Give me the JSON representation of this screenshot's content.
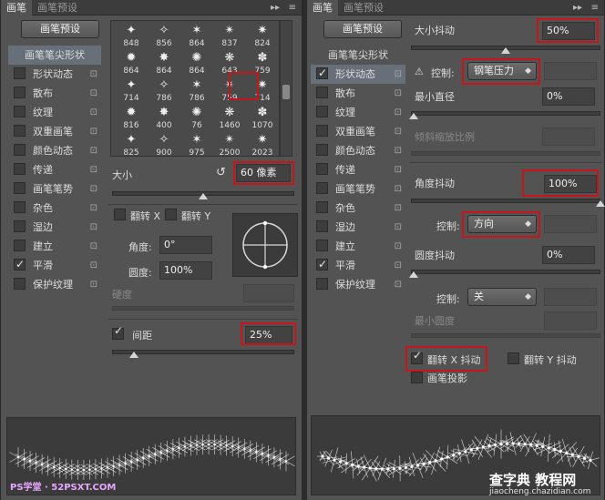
{
  "left_panel": {
    "tabs": [
      "画笔",
      "画笔预设"
    ],
    "preset_button": "画笔预设",
    "sidebar": [
      {
        "label": "画笔笔尖形状",
        "header": true,
        "selected": true
      },
      {
        "label": "形状动态",
        "checked": false
      },
      {
        "label": "散布",
        "checked": false
      },
      {
        "label": "纹理",
        "checked": false
      },
      {
        "label": "双重画笔",
        "checked": false
      },
      {
        "label": "颜色动态",
        "checked": false
      },
      {
        "label": "传递",
        "checked": false
      },
      {
        "label": "画笔笔势",
        "checked": false
      },
      {
        "label": "杂色",
        "checked": false
      },
      {
        "label": "湿边",
        "checked": false
      },
      {
        "label": "建立",
        "checked": false
      },
      {
        "label": "平滑",
        "checked": true
      },
      {
        "label": "保护纹理",
        "checked": false
      }
    ],
    "brush_tips": [
      [
        "848",
        "856",
        "864",
        "837",
        "824"
      ],
      [
        "864",
        "864",
        "864",
        "643",
        "759"
      ],
      [
        "714",
        "786",
        "786",
        "759",
        "714"
      ],
      [
        "816",
        "400",
        "76",
        "1460",
        "1070"
      ],
      [
        "825",
        "900",
        "975",
        "2500",
        "2023"
      ]
    ],
    "size_label": "大小",
    "size_value": "60 像素",
    "flip_x": "翻转 X",
    "flip_y": "翻转 Y",
    "angle_label": "角度:",
    "angle_value": "0°",
    "roundness_label": "圆度:",
    "roundness_value": "100%",
    "hardness_label": "硬度",
    "spacing_label": "间距",
    "spacing_value": "25%",
    "spacing_checked": true,
    "size_slider": 0.5,
    "spacing_slider": 0.12,
    "watermark": "PS学堂 · 52PSXT.COM"
  },
  "right_panel": {
    "tabs": [
      "画笔",
      "画笔预设"
    ],
    "preset_button": "画笔预设",
    "sidebar": [
      {
        "label": "画笔笔尖形状",
        "header": true,
        "selected": false
      },
      {
        "label": "形状动态",
        "checked": true,
        "selected": true
      },
      {
        "label": "散布",
        "checked": false
      },
      {
        "label": "纹理",
        "checked": false
      },
      {
        "label": "双重画笔",
        "checked": false
      },
      {
        "label": "颜色动态",
        "checked": false
      },
      {
        "label": "传递",
        "checked": false
      },
      {
        "label": "画笔笔势",
        "checked": false
      },
      {
        "label": "杂色",
        "checked": false
      },
      {
        "label": "湿边",
        "checked": false
      },
      {
        "label": "建立",
        "checked": false
      },
      {
        "label": "平滑",
        "checked": true
      },
      {
        "label": "保护纹理",
        "checked": false
      }
    ],
    "size_jitter_label": "大小抖动",
    "size_jitter_value": "50%",
    "control_label": "控制:",
    "size_control": "钢笔压力",
    "min_diameter_label": "最小直径",
    "min_diameter_value": "0%",
    "tilt_scale_label": "倾斜缩放比例",
    "angle_jitter_label": "角度抖动",
    "angle_jitter_value": "100%",
    "angle_control": "方向",
    "roundness_jitter_label": "圆度抖动",
    "roundness_jitter_value": "0%",
    "roundness_control": "关",
    "min_roundness_label": "最小圆度",
    "flip_x_jitter": "翻转 X 抖动",
    "flip_y_jitter": "翻转 Y 抖动",
    "brush_projection": "画笔投影",
    "size_jitter_slider": 0.5,
    "angle_jitter_slider": 1.0,
    "watermark_cn": "查字典 教程网",
    "watermark_url": "jiaocheng.chazidian.com"
  },
  "colors": {
    "panel": "#535353",
    "highlight": "#c8151c",
    "selected": "#676f79"
  }
}
